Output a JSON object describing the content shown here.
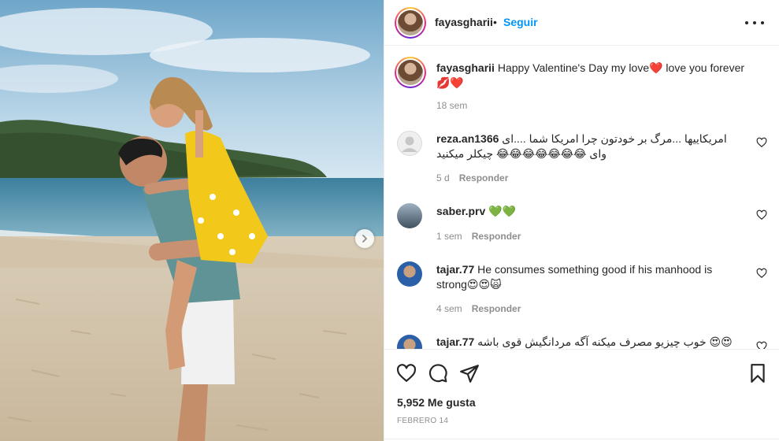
{
  "post": {
    "username": "fayasgharii",
    "dot": "•",
    "follow_label": "Seguir",
    "caption_text": "Happy Valentine's Day my love❤️ love you forever 💋❤️",
    "caption_time": "18 sem"
  },
  "comments": [
    {
      "username": "reza.an1366",
      "text": "امریکاییها ...مرگ بر خودتون چرا امریکا شما ....ای وای 😂😂😂😂😂😂😂 چیکلر میکنید",
      "time": "5 d",
      "reply_label": "Responder",
      "avatar_icon": "default-avatar-icon"
    },
    {
      "username": "saber.prv",
      "text": "💚💚",
      "time": "1 sem",
      "reply_label": "Responder"
    },
    {
      "username": "tajar.77",
      "text": "He consumes something good if his manhood is strong😍😍🙀",
      "time": "4 sem",
      "reply_label": "Responder"
    },
    {
      "username": "tajar.77",
      "text": "خوب چیزیو مصرف میکنه آگه مردانگیش قوی باشه 😍😍",
      "time": "",
      "reply_label": ""
    }
  ],
  "actions": {
    "likes": "5,952 Me gusta",
    "date": "FEBRERO 14"
  },
  "colors": {
    "accent": "#0095f6",
    "text": "#262626",
    "secondary": "#8e8e8e",
    "border": "#efefef"
  }
}
